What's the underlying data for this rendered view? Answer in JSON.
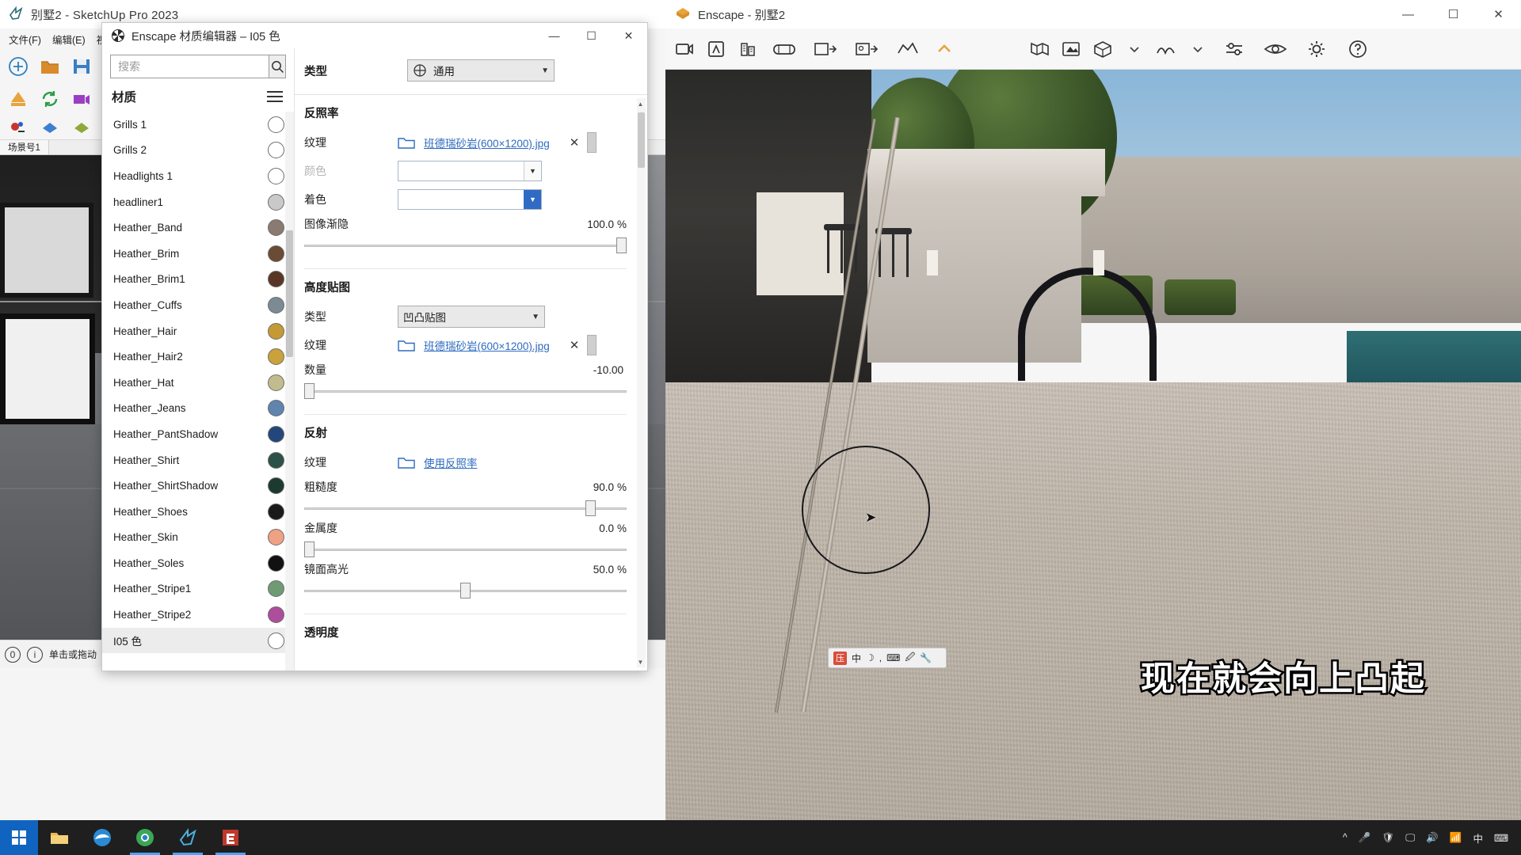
{
  "sketchup_window": {
    "title": "别墅2 - SketchUp Pro 2023",
    "logo_icon": "sketchup-logo-icon",
    "window_controls": {
      "minimize": "—",
      "maximize": "☐",
      "close": "✕"
    },
    "menus": [
      "文件(F)",
      "编辑(E)",
      "视图"
    ],
    "scene_tab": "场景号1",
    "status_text": "单击或拖动",
    "status_icons": [
      "info-circle-icon",
      "help-circle-icon"
    ]
  },
  "enscape_window": {
    "title": "Enscape - 别墅2",
    "logo_icon": "enscape-logo-icon",
    "window_controls": {
      "minimize": "—",
      "maximize": "☐",
      "close": "✕"
    },
    "toolbar_icons": [
      "video-render-icon",
      "assets-library-icon",
      "building-icon",
      "panorama-icon",
      "export-image-icon",
      "export-panorama-icon",
      "batch-export-icon",
      "path-animation-icon",
      "chevron-up-icon",
      "map-icon",
      "site-context-icon",
      "box-geometry-icon",
      "chevron-down-icon",
      "atmosphere-icon",
      "chevron-down-icon-2",
      "settings-sliders-icon",
      "visual-settings-icon",
      "gear-icon",
      "help-icon"
    ],
    "ime_bar": {
      "mode_badge": "压",
      "language": "中",
      "icons": [
        "moon-icon",
        "comma-icon",
        "keyboard-icon",
        "tools-icon",
        "wrench-icon"
      ]
    },
    "subtitle_overlay": "现在就会向上凸起"
  },
  "material_editor": {
    "title": "Enscape 材质编辑器 – I05 色",
    "icon": "checker-material-icon",
    "window_controls": {
      "minimize": "—",
      "maximize": "☐",
      "close": "✕"
    },
    "search": {
      "placeholder": "搜索",
      "value": "",
      "icon": "search-icon"
    },
    "list_header": {
      "title": "材质",
      "menu_icon": "hamburger-menu-icon"
    },
    "materials": [
      {
        "name": "Grills 1",
        "color": "#ffffff"
      },
      {
        "name": "Grills 2",
        "color": "#ffffff"
      },
      {
        "name": "Headlights 1",
        "color": "#ffffff"
      },
      {
        "name": "headliner1",
        "color": "#c9c9c9"
      },
      {
        "name": "Heather_Band",
        "color": "#8a7a72"
      },
      {
        "name": "Heather_Brim",
        "color": "#6b4a36"
      },
      {
        "name": "Heather_Brim1",
        "color": "#593526"
      },
      {
        "name": "Heather_Cuffs",
        "color": "#7b8a93"
      },
      {
        "name": "Heather_Hair",
        "color": "#c59a35"
      },
      {
        "name": "Heather_Hair2",
        "color": "#c9a23c"
      },
      {
        "name": "Heather_Hat",
        "color": "#c2bb8d"
      },
      {
        "name": "Heather_Jeans",
        "color": "#5f84ad"
      },
      {
        "name": "Heather_PantShadow",
        "color": "#23477a"
      },
      {
        "name": "Heather_Shirt",
        "color": "#2b5148"
      },
      {
        "name": "Heather_ShirtShadow",
        "color": "#1d3a30"
      },
      {
        "name": "Heather_Shoes",
        "color": "#1a1a1a"
      },
      {
        "name": "Heather_Skin",
        "color": "#f0a184"
      },
      {
        "name": "Heather_Soles",
        "color": "#111111"
      },
      {
        "name": "Heather_Stripe1",
        "color": "#6f9b74"
      },
      {
        "name": "Heather_Stripe2",
        "color": "#ad4d9c"
      },
      {
        "name": "I05 色",
        "color": "#ffffff"
      }
    ],
    "selected_material": "I05 色",
    "type_row": {
      "label": "类型",
      "value": "通用",
      "icon": "material-type-icon",
      "arrow": "chevron-down-icon"
    },
    "sections": [
      {
        "id": "albedo",
        "title": "反照率",
        "texture": {
          "label": "纹理",
          "file": "班德瑞砂岩(600×1200).jpg",
          "folder_icon": "folder-icon",
          "clear_icon": "close-icon",
          "has_thumb": true
        },
        "color": {
          "label": "颜色",
          "dimmed": true,
          "value": "",
          "arrow": "chevron-down-icon"
        },
        "tint": {
          "label": "着色",
          "dimmed": false,
          "value": "",
          "arrow": "chevron-down-icon",
          "active": true
        },
        "slider": {
          "label": "图像渐隐",
          "value": "100.0",
          "unit": "%",
          "percent": 100
        }
      },
      {
        "id": "height_map",
        "title": "高度贴图",
        "type_row": {
          "label": "类型",
          "value": "凹凸贴图",
          "arrow": "chevron-down-icon"
        },
        "texture": {
          "label": "纹理",
          "file": "班德瑞砂岩(600×1200).jpg",
          "folder_icon": "folder-icon",
          "clear_icon": "close-icon",
          "has_thumb": true
        },
        "slider": {
          "label": "数量",
          "value": "-10.00",
          "unit": "",
          "percent": 0
        }
      },
      {
        "id": "reflection",
        "title": "反射",
        "texture": {
          "label": "纹理",
          "file": "使用反照率",
          "folder_icon": "folder-icon",
          "clear_icon": "",
          "has_thumb": false
        },
        "sliders": [
          {
            "label": "粗糙度",
            "value": "90.0",
            "unit": "%",
            "percent": 90
          },
          {
            "label": "金属度",
            "value": "0.0",
            "unit": "%",
            "percent": 0
          },
          {
            "label": "镜面高光",
            "value": "50.0",
            "unit": "%",
            "percent": 50
          }
        ]
      },
      {
        "id": "transparency",
        "title": "透明度"
      }
    ],
    "scroll": {
      "up_arrow": "chevron-up-icon",
      "down_arrow": "chevron-down-icon"
    }
  },
  "taskbar": {
    "start_icon": "windows-start-icon",
    "items": [
      "file-explorer-icon",
      "edge-browser-icon",
      "chrome-icon",
      "sketchup-taskbar-icon",
      "enscape-taskbar-icon"
    ],
    "tray": {
      "chevron": "^",
      "icons": [
        "mic-icon",
        "shield-icon",
        "display-icon",
        "volume-icon",
        "network-icon"
      ],
      "language": "中",
      "ime_icon": "ime-icon"
    }
  },
  "colors": {
    "link": "#2e6bbf",
    "selection": "#ececec",
    "accent": "#1064c0",
    "enscape_orange": "#e8a33d"
  }
}
